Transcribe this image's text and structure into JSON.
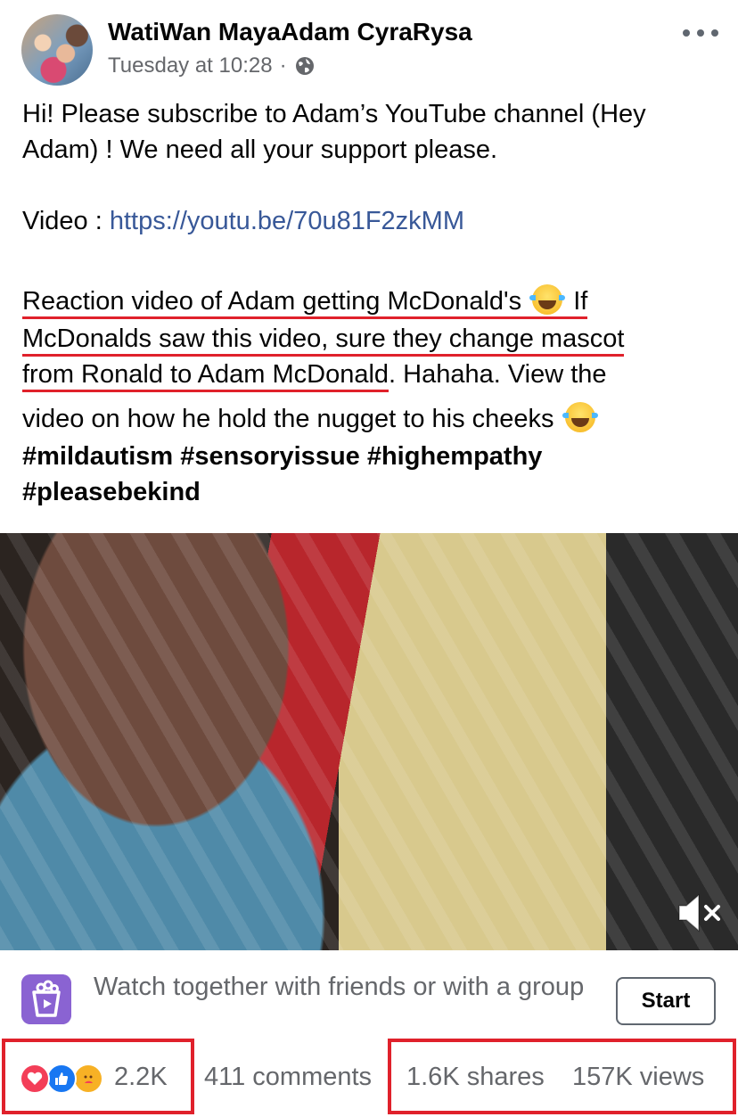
{
  "post": {
    "author": "WatiWan MayaAdam CyraRysa",
    "timestamp": "Tuesday at 10:28",
    "separator": "·",
    "text_lines": [
      "Hi! Please subscribe to Adam’s YouTube channel (Hey",
      "Adam) ! We need all your support please."
    ],
    "video_label": "Video : ",
    "video_link": "https://youtu.be/70u81F2zkMM",
    "reaction_line1_a": "Reaction video of Adam getting McDonald's",
    "reaction_line1_b": "If",
    "reaction_line2": "McDonalds saw this video, sure they change mascot",
    "reaction_line3_a": "from Ronald to Adam McDonald",
    "reaction_line3_b": ". Hahaha. View the",
    "reaction_line4": "video on how he hold the nugget to his cheeks",
    "hashtags_line1": "#mildautism #sensoryissue #highempathy",
    "hashtags_line2": "#pleasebekind",
    "emoji_name": "face-with-tears-of-joy"
  },
  "watch_party": {
    "text": "Watch together with friends or with a group",
    "button": "Start"
  },
  "stats": {
    "reaction_count": "2.2K",
    "comments": "411 comments",
    "shares": "1.6K shares",
    "views": "157K views",
    "reaction_types": [
      "love",
      "like",
      "care"
    ]
  },
  "colors": {
    "link": "#385898",
    "secondary_text": "#65676b",
    "annotation_red": "#e0212b",
    "like_blue": "#1877f2",
    "love_red": "#f33e58",
    "care_yellow": "#f7b125"
  }
}
